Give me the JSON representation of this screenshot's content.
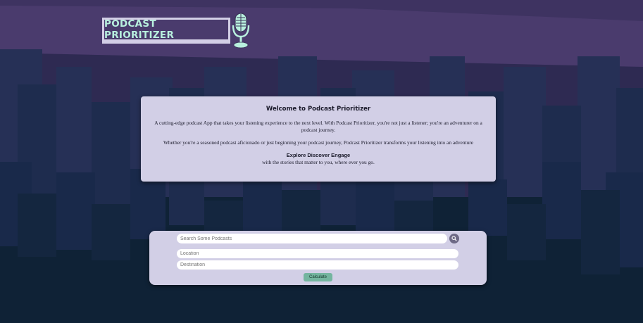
{
  "app": {
    "logo_text": "PODCAST PRIORITIZER"
  },
  "welcome": {
    "title": "Welcome to Podcast Prioritizer",
    "paragraph1": "A cutting-edge podcast App that takes your listening experience to the next level. With Podcast Prioritizer, you're not just a listener; you're an adventurer on a podcast journey.",
    "paragraph2": "Whether you're a seasoned podcast aficionado or just beginning your podcast journey, Podcast Prioritizer transforms your listening into an adventure",
    "tagline": "Explore Discover Engage",
    "subtagline": "with the stories that matter to you, where ever you go."
  },
  "form": {
    "search_placeholder": "Search Some Podcasts",
    "location_placeholder": "Location",
    "destination_placeholder": "Destination",
    "calculate_label": "Calculate"
  },
  "icons": {
    "logo": "microphone-icon",
    "search": "search-icon"
  },
  "colors": {
    "background_dark": "#0f2236",
    "background_purple": "#4a3b6d",
    "panel": "#d2cfe6",
    "logo_text": "#b8f0de",
    "button": "#74b59f"
  }
}
